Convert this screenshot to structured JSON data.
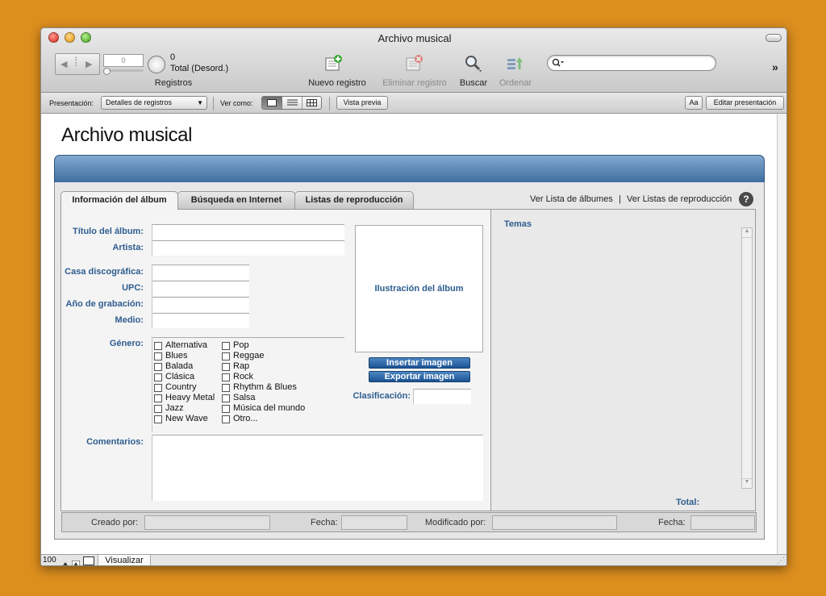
{
  "window": {
    "title": "Archivo musical"
  },
  "toolbar": {
    "record_number": "0",
    "record_count": "0",
    "record_total": "Total (Desord.)",
    "records_label": "Registros",
    "new_record": "Nuevo registro",
    "delete_record": "Eliminar registro",
    "find": "Buscar",
    "sort": "Ordenar",
    "search_placeholder": ""
  },
  "layout_bar": {
    "presentation_label": "Presentación:",
    "presentation_value": "Detalles de registros",
    "view_as_label": "Ver como:",
    "preview_button": "Vista previa",
    "font_button": "Aa",
    "edit_layout_button": "Editar presentación"
  },
  "layout": {
    "title": "Archivo musical",
    "tabs": [
      {
        "label": "Información del álbum"
      },
      {
        "label": "Búsqueda en Internet"
      },
      {
        "label": "Listas de reproducción"
      }
    ],
    "links": {
      "albums": "Ver Lista de álbumes",
      "separator": "|",
      "playlists": "Ver Listas de reproducción"
    },
    "help": "?",
    "fields": {
      "album_title": "Título del álbum:",
      "artist": "Artista:",
      "label": "Casa discográfica:",
      "upc": "UPC:",
      "year": "Año de grabación:",
      "medium": "Medio:",
      "genre": "Género:",
      "comments": "Comentarios:",
      "rating": "Clasificación:"
    },
    "genres_left": [
      "Alternativa",
      "Blues",
      "Balada",
      "Clásica",
      "Country",
      "Heavy Metal",
      "Jazz",
      "New Wave"
    ],
    "genres_right": [
      "Pop",
      "Reggae",
      "Rap",
      "Rock",
      "Rhythm & Blues",
      "Salsa",
      "Música del mundo",
      "Otro..."
    ],
    "artwork": "Ilustración del álbum",
    "insert_image": "Insertar imagen",
    "export_image": "Exportar imagen",
    "tracks_label": "Temas",
    "total_label": "Total:",
    "footer": {
      "created_by": "Creado por:",
      "date1": "Fecha:",
      "modified_by": "Modificado por:",
      "date2": "Fecha:"
    }
  },
  "status": {
    "zoom": "100",
    "mode": "Visualizar"
  },
  "colors": {
    "background": "#dd8f1e",
    "header_blue": "#3f6e9f",
    "label_blue": "#2e5d8f"
  }
}
